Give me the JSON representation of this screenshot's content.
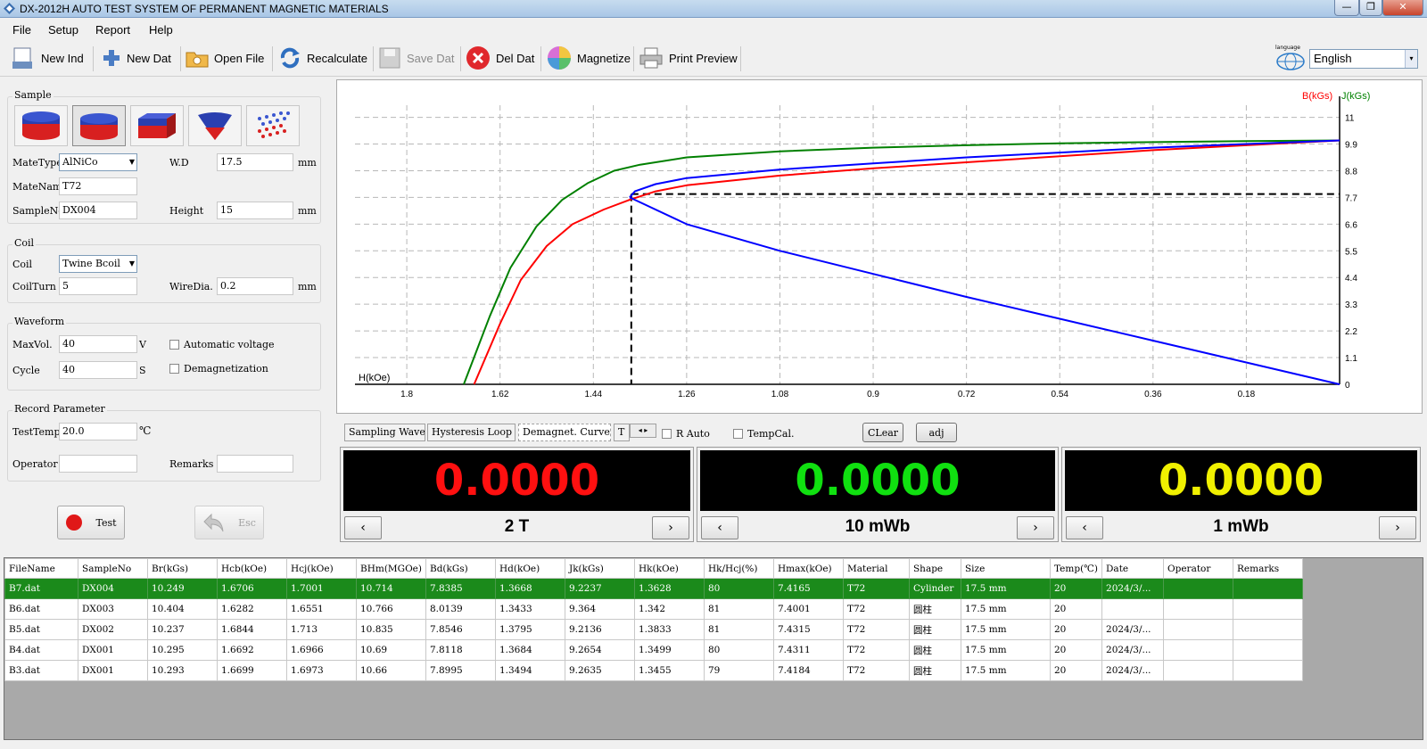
{
  "window": {
    "title": "DX-2012H AUTO TEST SYSTEM OF PERMANENT MAGNETIC MATERIALS",
    "minimize": "—",
    "restore": "❐",
    "close": "✕"
  },
  "menu": [
    "File",
    "Setup",
    "Report",
    "Help"
  ],
  "toolbar": {
    "new_ind": "New Ind",
    "new_dat": "New Dat",
    "open_file": "Open File",
    "recalculate": "Recalculate",
    "save_dat": "Save Dat",
    "del_dat": "Del Dat",
    "magnetize": "Magnetize",
    "print_preview": "Print Preview",
    "language_label": "language",
    "language_value": "English"
  },
  "sample": {
    "title": "Sample",
    "mate_type_label": "MateType",
    "mate_type": "AlNiCo",
    "mate_name_label": "MateName",
    "mate_name": "T72",
    "sample_no_label": "SampleNo",
    "sample_no": "DX004",
    "wd_label": "W.D",
    "wd": "17.5",
    "wd_unit": "mm",
    "height_label": "Height",
    "height": "15",
    "height_unit": "mm"
  },
  "coil": {
    "title": "Coil",
    "coil_label": "Coil",
    "coil": "Twine Bcoil",
    "coil_turn_label": "CoilTurn",
    "coil_turn": "5",
    "wire_dia_label": "WireDia.",
    "wire_dia": "0.2",
    "wire_dia_unit": "mm"
  },
  "waveform": {
    "title": "Waveform",
    "max_vol_label": "MaxVol.",
    "max_vol": "40",
    "max_vol_unit": "V",
    "cycle_label": "Cycle",
    "cycle": "40",
    "cycle_unit": "S",
    "auto_voltage": "Automatic voltage",
    "demagnetization": "Demagnetization"
  },
  "record": {
    "title": "Record Parameter",
    "test_temp_label": "TestTemp",
    "test_temp": "20.0",
    "test_temp_unit": "℃",
    "operator_label": "Operator",
    "operator": "",
    "remarks_label": "Remarks",
    "remarks": ""
  },
  "actions": {
    "test": "Test",
    "esc": "Esc"
  },
  "tabs": [
    "Sampling Wave",
    "Hysteresis Loop",
    "Demagnet. Curve",
    "T"
  ],
  "chart_controls": {
    "r_auto": "R Auto",
    "temp_cal": "TempCal.",
    "clear": "CLear",
    "adj": "adj"
  },
  "meters": [
    {
      "value": "0.0000",
      "color": "#ff1010",
      "range": "2  T"
    },
    {
      "value": "0.0000",
      "color": "#10e010",
      "range": "10 mWb"
    },
    {
      "value": "0.0000",
      "color": "#f0f000",
      "range": "1 mWb"
    }
  ],
  "chart_data": {
    "type": "line",
    "xlabel": "H(kOe)",
    "ylabel_b": "B(kGs)",
    "ylabel_j": "J(kGs)",
    "x_ticks": [
      "1.8",
      "1.62",
      "1.44",
      "1.26",
      "1.08",
      "0.9",
      "0.72",
      "0.54",
      "0.36",
      "0.18"
    ],
    "y_ticks": [
      "0",
      "1.1",
      "2.2",
      "3.3",
      "4.4",
      "5.5",
      "6.6",
      "7.7",
      "8.8",
      "9.9",
      "11"
    ],
    "xlim": [
      1.9,
      0.0
    ],
    "ylim": [
      0,
      11.5
    ],
    "x_reversed": true,
    "grid": true,
    "colors": {
      "B": "#ff0000",
      "J": "#008000",
      "BH": "#0000ff",
      "B_label": "#ff0000",
      "J_label": "#008000"
    },
    "series": [
      {
        "name": "J(kGs)",
        "color": "#008000",
        "x": [
          1.69,
          1.64,
          1.6,
          1.55,
          1.5,
          1.45,
          1.4,
          1.35,
          1.26,
          1.08,
          0.9,
          0.72,
          0.54,
          0.36,
          0.18,
          0.0
        ],
        "y": [
          0.0,
          2.8,
          4.8,
          6.5,
          7.6,
          8.3,
          8.8,
          9.05,
          9.35,
          9.6,
          9.75,
          9.85,
          9.93,
          9.98,
          10.02,
          10.05
        ]
      },
      {
        "name": "B(kGs)",
        "color": "#ff0000",
        "x": [
          1.67,
          1.62,
          1.58,
          1.53,
          1.48,
          1.42,
          1.37,
          1.32,
          1.26,
          1.08,
          0.9,
          0.72,
          0.54,
          0.36,
          0.18,
          0.0
        ],
        "y": [
          0.0,
          2.5,
          4.3,
          5.7,
          6.6,
          7.2,
          7.6,
          7.95,
          8.2,
          8.6,
          8.9,
          9.15,
          9.4,
          9.65,
          9.85,
          10.05
        ]
      },
      {
        "name": "B(kGs)",
        "color": "#0000ff",
        "x": [
          1.37,
          1.36,
          1.32,
          1.26,
          1.08,
          0.9,
          0.72,
          0.54,
          0.36,
          0.18,
          0.0
        ],
        "y": [
          7.7,
          7.95,
          8.25,
          8.5,
          8.85,
          9.1,
          9.35,
          9.55,
          9.75,
          9.9,
          10.05
        ]
      },
      {
        "name": "BH",
        "color": "#0000ff",
        "x": [
          1.37,
          1.26,
          1.08,
          0.9,
          0.72,
          0.54,
          0.36,
          0.18,
          0.0
        ],
        "y": [
          7.7,
          6.6,
          5.5,
          4.55,
          3.6,
          2.7,
          1.8,
          0.9,
          0.0
        ]
      }
    ],
    "markers": {
      "hd": 1.3668,
      "bd": 7.8385
    }
  },
  "table": {
    "columns": [
      "FileName",
      "SampleNo",
      "Br(kGs)",
      "Hcb(kOe)",
      "Hcj(kOe)",
      "BHm(MGOe)",
      "Bd(kGs)",
      "Hd(kOe)",
      "Jk(kGs)",
      "Hk(kOe)",
      "Hk/Hcj(%)",
      "Hmax(kOe)",
      "Material",
      "Shape",
      "Size",
      "Temp(℃)",
      "Date",
      "Operator",
      "Remarks"
    ],
    "rows": [
      [
        "B7.dat",
        "DX004",
        "10.249",
        "1.6706",
        "1.7001",
        "10.714",
        "7.8385",
        "1.3668",
        "9.2237",
        "1.3628",
        "80",
        "7.4165",
        "T72",
        "Cylinder",
        "17.5 mm",
        "20",
        "2024/3/...",
        "",
        ""
      ],
      [
        "B6.dat",
        "DX003",
        "10.404",
        "1.6282",
        "1.6551",
        "10.766",
        "8.0139",
        "1.3433",
        "9.364",
        "1.342",
        "81",
        "7.4001",
        "T72",
        "圆柱",
        "17.5 mm",
        "20",
        "",
        "",
        ""
      ],
      [
        "B5.dat",
        "DX002",
        "10.237",
        "1.6844",
        "1.713",
        "10.835",
        "7.8546",
        "1.3795",
        "9.2136",
        "1.3833",
        "81",
        "7.4315",
        "T72",
        "圆柱",
        "17.5 mm",
        "20",
        "2024/3/...",
        "",
        ""
      ],
      [
        "B4.dat",
        "DX001",
        "10.295",
        "1.6692",
        "1.6966",
        "10.69",
        "7.8118",
        "1.3684",
        "9.2654",
        "1.3499",
        "80",
        "7.4311",
        "T72",
        "圆柱",
        "17.5 mm",
        "20",
        "2024/3/...",
        "",
        ""
      ],
      [
        "B3.dat",
        "DX001",
        "10.293",
        "1.6699",
        "1.6973",
        "10.66",
        "7.8995",
        "1.3494",
        "9.2635",
        "1.3455",
        "79",
        "7.4184",
        "T72",
        "圆柱",
        "17.5 mm",
        "20",
        "2024/3/...",
        "",
        ""
      ]
    ]
  }
}
